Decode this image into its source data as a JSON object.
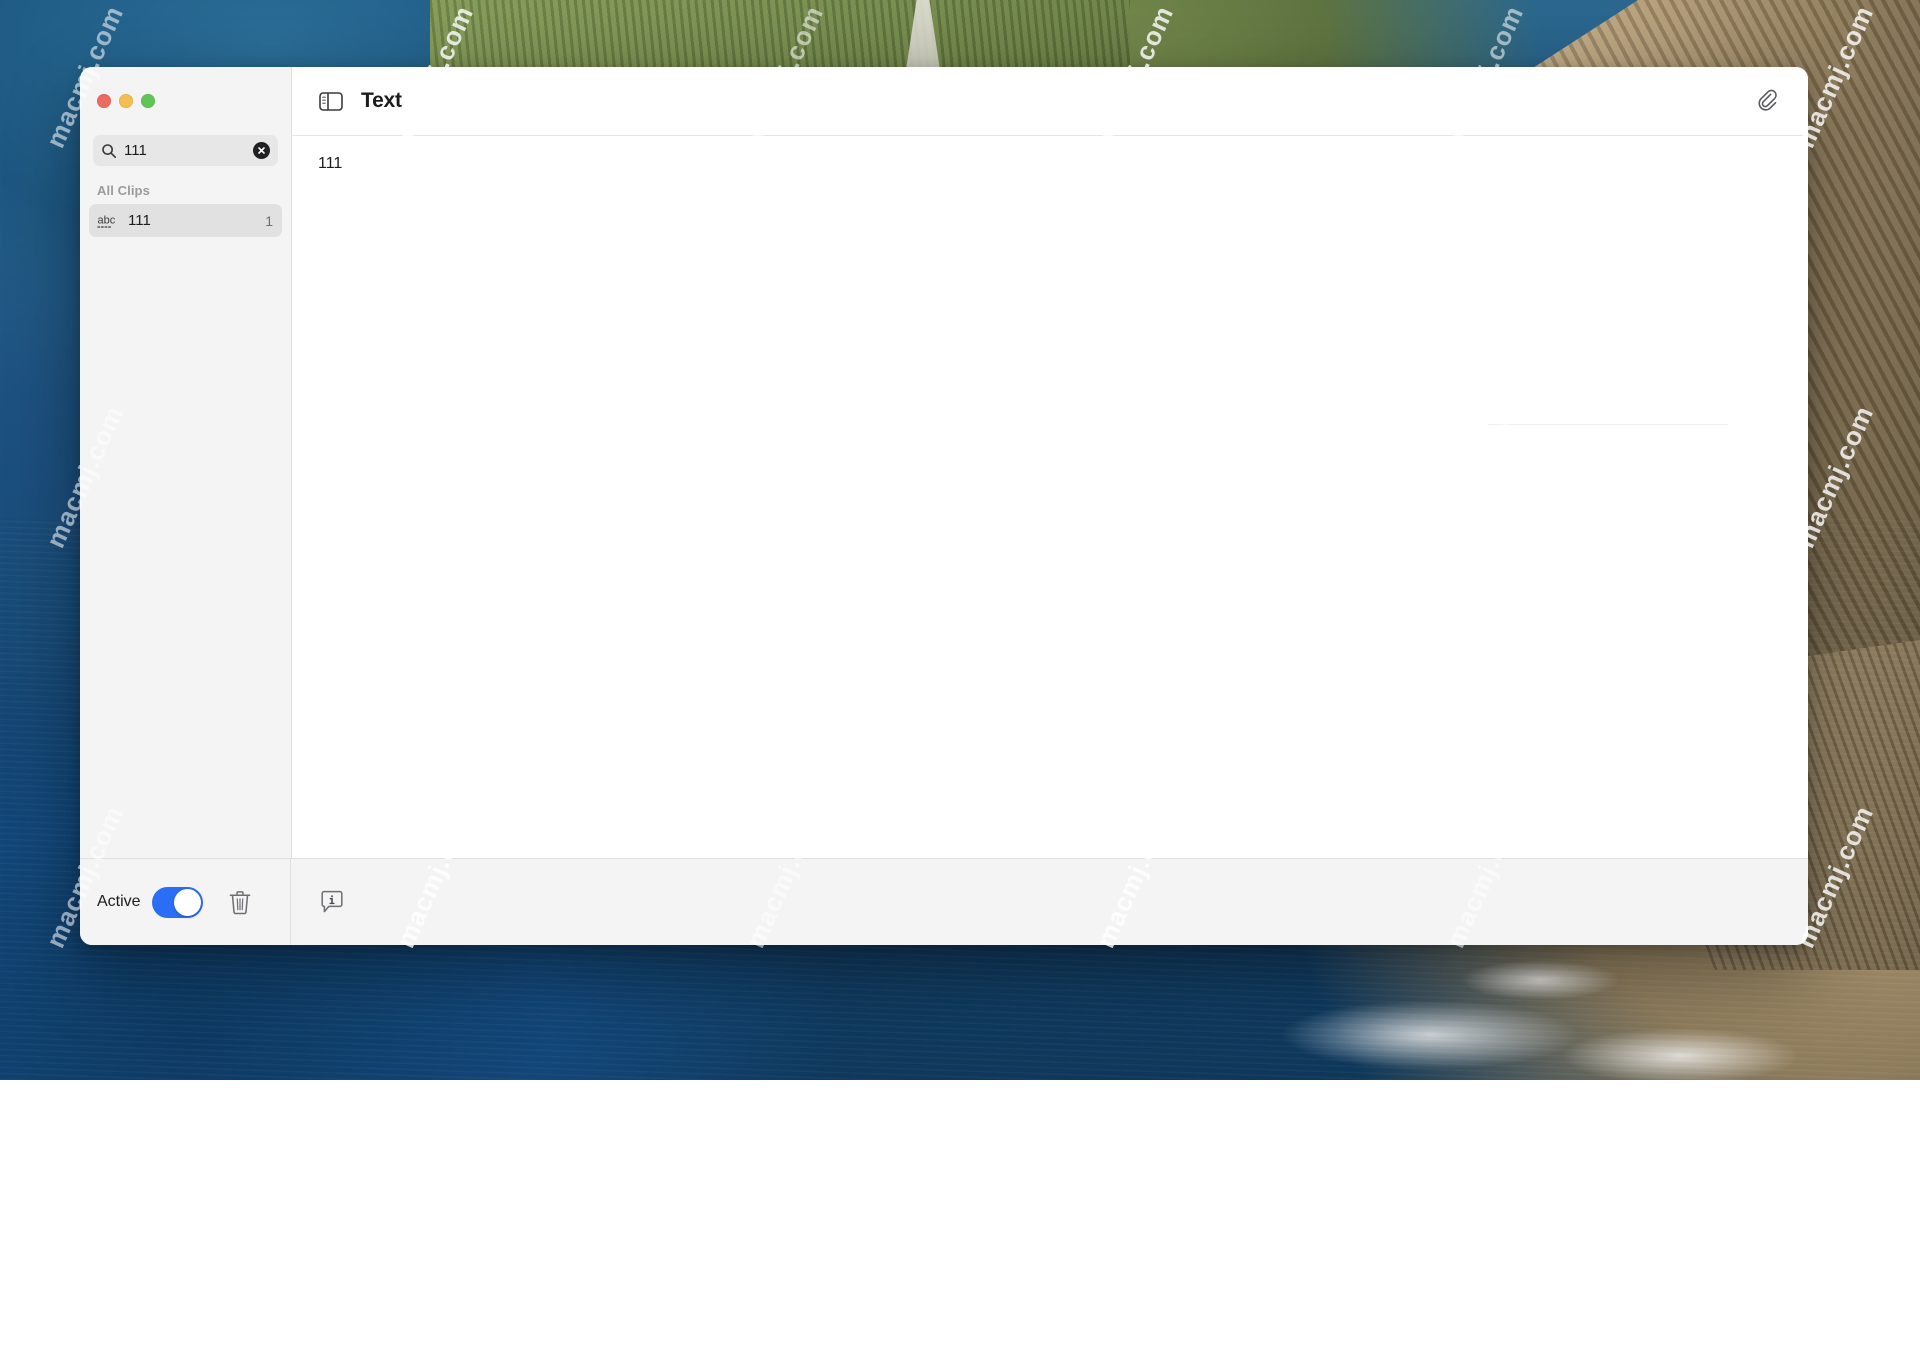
{
  "window": {
    "title": "Text",
    "traffic_lights": [
      {
        "name": "close",
        "color": "#ec6a5f"
      },
      {
        "name": "minimize",
        "color": "#f4bd4f"
      },
      {
        "name": "zoom",
        "color": "#61c554"
      }
    ]
  },
  "sidebar": {
    "search": {
      "value": "111",
      "placeholder": "Search",
      "icon": "search-icon",
      "clear_icon": "clear-circle-icon"
    },
    "group_header": "All Clips",
    "clips": [
      {
        "icon": "abc-text-icon",
        "title": "111",
        "count": "1"
      }
    ]
  },
  "toolbar": {
    "sidebar_toggle_icon": "sidebar-toggle-icon",
    "title": "Text",
    "attachment_icon": "paperclip-icon"
  },
  "editor": {
    "text": "111"
  },
  "bottom_bar": {
    "active_label": "Active",
    "active_on": true,
    "toggle_color": "#2b6ef6",
    "delete_icon": "trash-icon",
    "info_icon": "info-bubble-icon"
  },
  "watermark": {
    "text": "macmj.com"
  }
}
